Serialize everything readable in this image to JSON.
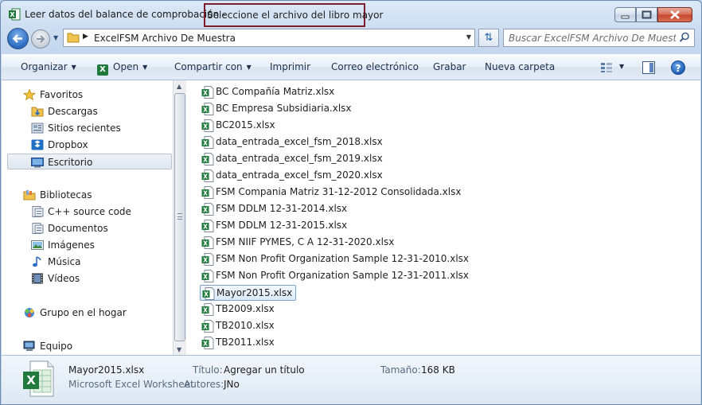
{
  "window": {
    "title": "Leer datos del balance de comprobación  -",
    "title_highlight": "Seleccione el archivo del libro mayor"
  },
  "address": {
    "path": "ExcelFSM Archivo De Muestra",
    "search_placeholder": "Buscar ExcelFSM Archivo De Muestra"
  },
  "toolbar": {
    "organize": "Organizar",
    "open": "Open",
    "share": "Compartir con",
    "print": "Imprimir",
    "email": "Correo electrónico",
    "burn": "Grabar",
    "new_folder": "Nueva carpeta"
  },
  "nav": {
    "favorites": "Favoritos",
    "downloads": "Descargas",
    "recent": "Sitios recientes",
    "dropbox": "Dropbox",
    "desktop": "Escritorio",
    "libraries": "Bibliotecas",
    "cpp": "C++ source code",
    "documents": "Documentos",
    "images": "Imágenes",
    "music": "Música",
    "videos": "Vídeos",
    "homegroup": "Grupo en el hogar",
    "computer": "Equipo"
  },
  "files": [
    "BC Compañía Matriz.xlsx",
    "BC Empresa Subsidiaria.xlsx",
    "BC2015.xlsx",
    "data_entrada_excel_fsm_2018.xlsx",
    "data_entrada_excel_fsm_2019.xlsx",
    "data_entrada_excel_fsm_2020.xlsx",
    "FSM Compania Matriz 31-12-2012 Consolidada.xlsx",
    "FSM DDLM 12-31-2014.xlsx",
    "FSM DDLM 12-31-2015.xlsx",
    "FSM NIIF PYMES, C A  12-31-2020.xlsx",
    "FSM Non Profit Organization Sample 12-31-2010.xlsx",
    "FSM Non Profit Organization Sample 12-31-2011.xlsx",
    "Mayor2015.xlsx",
    "TB2009.xlsx",
    "TB2010.xlsx",
    "TB2011.xlsx"
  ],
  "selected_file_index": 12,
  "details": {
    "name": "Mayor2015.xlsx",
    "type": "Microsoft Excel Worksheet",
    "title_label": "Título:",
    "title_value": "Agregar un título",
    "authors_label": "Autores:",
    "authors_value": "JNo",
    "size_label": "Tamaño:",
    "size_value": "168 KB"
  },
  "colors": {
    "highlight_border": "#7e1d2b",
    "excel_green": "#1f7a3c"
  }
}
